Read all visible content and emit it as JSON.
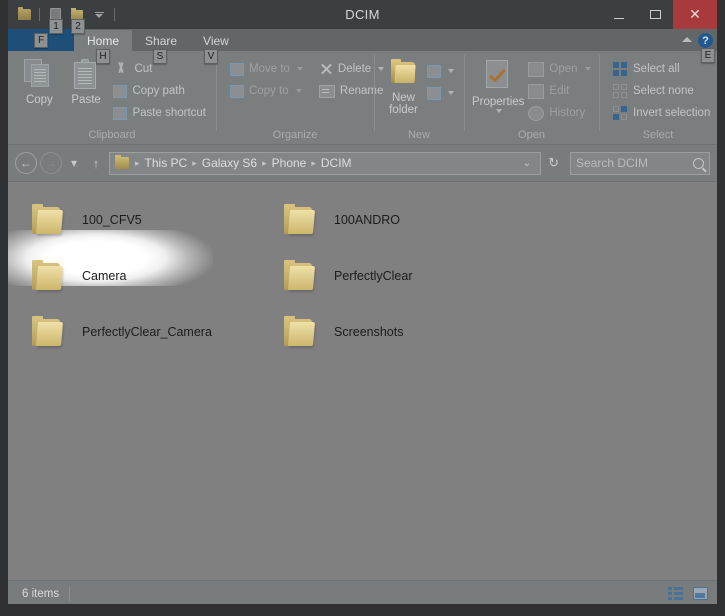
{
  "window": {
    "title": "DCIM",
    "minimize_label": "—",
    "maximize_label": "",
    "close_label": "✕"
  },
  "quick_access": {
    "items": [
      {
        "name": "properties-quick",
        "keytip": "1"
      },
      {
        "name": "new-folder-quick",
        "keytip": "2"
      }
    ],
    "customize_label": ""
  },
  "ribbon": {
    "file_tab": {
      "label": "",
      "keytip": "F"
    },
    "tabs": [
      {
        "label": "Home",
        "keytip": "H",
        "active": true
      },
      {
        "label": "Share",
        "keytip": "S",
        "active": false
      },
      {
        "label": "View",
        "keytip": "V",
        "active": false
      }
    ],
    "help_label": "?",
    "help_keytip": "E",
    "groups": [
      {
        "name": "clipboard",
        "label": "Clipboard",
        "big_buttons": [
          {
            "label": "Copy",
            "icon": "copy-icon"
          },
          {
            "label": "Paste",
            "icon": "paste-icon"
          }
        ],
        "small_buttons": [
          {
            "label": "Cut",
            "icon": "scissors-icon"
          },
          {
            "label": "Copy path",
            "icon": "copy-path-icon"
          },
          {
            "label": "Paste shortcut",
            "icon": "paste-shortcut-icon"
          }
        ]
      },
      {
        "name": "organize",
        "label": "Organize",
        "small_buttons": [
          {
            "label": "Move to",
            "icon": "move-to-icon",
            "has_caret": true
          },
          {
            "label": "Copy to",
            "icon": "copy-to-icon",
            "has_caret": true
          },
          {
            "label": "Delete",
            "icon": "delete-x-icon",
            "has_caret": true
          },
          {
            "label": "Rename",
            "icon": "rename-icon",
            "has_caret": false
          }
        ]
      },
      {
        "name": "new",
        "label": "New",
        "big_buttons": [
          {
            "label": "New\nfolder",
            "label_line1": "New",
            "label_line2": "folder",
            "icon": "new-folder-icon"
          }
        ],
        "small_buttons": [
          {
            "label": "",
            "icon": "new-item-icon",
            "has_caret": true
          },
          {
            "label": "",
            "icon": "easy-access-icon",
            "has_caret": true
          }
        ]
      },
      {
        "name": "open",
        "label": "Open",
        "big_buttons": [
          {
            "label": "Properties",
            "icon": "properties-icon"
          }
        ],
        "small_buttons": [
          {
            "label": "Open",
            "icon": "open-icon",
            "has_caret": true
          },
          {
            "label": "Edit",
            "icon": "edit-icon",
            "has_caret": false
          },
          {
            "label": "History",
            "icon": "history-icon",
            "has_caret": false
          }
        ]
      },
      {
        "name": "select",
        "label": "Select",
        "small_buttons": [
          {
            "label": "Select all",
            "icon": "select-all-icon"
          },
          {
            "label": "Select none",
            "icon": "select-none-icon"
          },
          {
            "label": "Invert selection",
            "icon": "invert-selection-icon"
          }
        ]
      }
    ]
  },
  "address_bar": {
    "back_label": "←",
    "forward_label": "→",
    "recent_label": "▾",
    "up_label": "↑",
    "breadcrumbs": [
      "This PC",
      "Galaxy S6",
      "Phone",
      "DCIM"
    ],
    "separator": "▸",
    "dropdown_label": "⌄",
    "refresh_label": "↻"
  },
  "search": {
    "placeholder": "Search DCIM"
  },
  "files": {
    "items": [
      {
        "name": "100_CFV5",
        "type": "folder",
        "highlighted": false
      },
      {
        "name": "100ANDRO",
        "type": "folder",
        "highlighted": false
      },
      {
        "name": "Camera",
        "type": "folder",
        "highlighted": true
      },
      {
        "name": "PerfectlyClear",
        "type": "folder",
        "highlighted": false
      },
      {
        "name": "PerfectlyClear_Camera",
        "type": "folder",
        "highlighted": false
      },
      {
        "name": "Screenshots",
        "type": "folder",
        "highlighted": false
      }
    ]
  },
  "status_bar": {
    "item_count": "6 items",
    "view_details_label": "",
    "view_icons_label": ""
  },
  "colors": {
    "accent_blue": "#1d4f78",
    "close_red": "#a8393c",
    "folder_yellow": "#d6c27e",
    "scrim_gray": "#808080",
    "highlight_white": "#ffffff"
  }
}
